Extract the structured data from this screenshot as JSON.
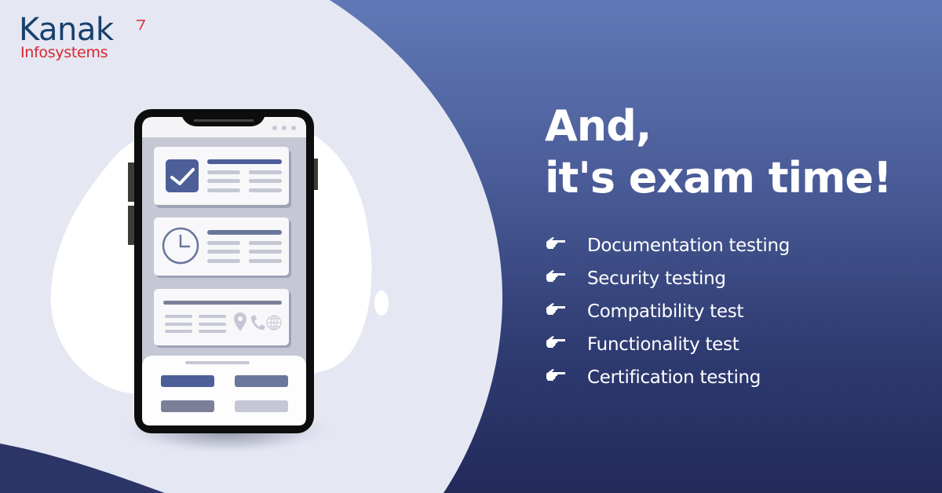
{
  "brand": {
    "name": "Kanak",
    "subtitle": "Infosystems",
    "colors": {
      "primary": "#17406d",
      "accent": "#d8262d"
    }
  },
  "headline": {
    "line1": "And,",
    "line2": "it's exam time!"
  },
  "bullet_icon": "pointing-hand-icon",
  "items": [
    {
      "label": "Documentation testing"
    },
    {
      "label": "Security testing"
    },
    {
      "label": "Compatibility test"
    },
    {
      "label": "Functionality test"
    },
    {
      "label": "Certification testing"
    }
  ],
  "illustration": {
    "device": "smartphone",
    "cards": [
      {
        "icon": "checkbox-checked-icon"
      },
      {
        "icon": "clock-icon"
      },
      {
        "icons": [
          "location-pin-icon",
          "phone-icon",
          "globe-icon"
        ]
      }
    ]
  },
  "colors": {
    "background_light": "#e5e7f3",
    "panel_top": "#6079b6",
    "panel_bottom": "#232c5c",
    "card_accent": "#4d5f98"
  }
}
